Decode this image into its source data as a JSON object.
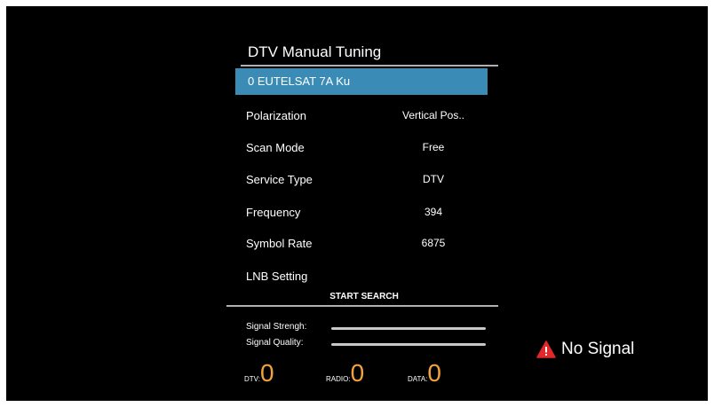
{
  "colors": {
    "background": "#000000",
    "highlight": "#3a8cb7",
    "count_value": "#f2a23c",
    "warning": "#e3272a"
  },
  "panel": {
    "title": "DTV Manual Tuning",
    "satellite": "0 EUTELSAT 7A Ku",
    "rows": [
      {
        "label": "Polarization",
        "value": "Vertical Pos.."
      },
      {
        "label": "Scan Mode",
        "value": "Free"
      },
      {
        "label": "Service Type",
        "value": "DTV"
      },
      {
        "label": "Frequency",
        "value": "394"
      },
      {
        "label": "Symbol Rate",
        "value": "6875"
      },
      {
        "label": "LNB Setting",
        "value": ""
      }
    ],
    "start_search": "START SEARCH"
  },
  "signal": {
    "strength_label": "Signal Strengh:",
    "strength_level": 1.0,
    "quality_label": "Signal Quality:",
    "quality_level": 1.0
  },
  "counts": {
    "dtv_label": "DTV:",
    "dtv_value": "0",
    "radio_label": "RADIO:",
    "radio_value": "0",
    "data_label": "DATA:",
    "data_value": "0"
  },
  "status": {
    "icon": "warning-triangle-icon",
    "text": "No Signal"
  }
}
